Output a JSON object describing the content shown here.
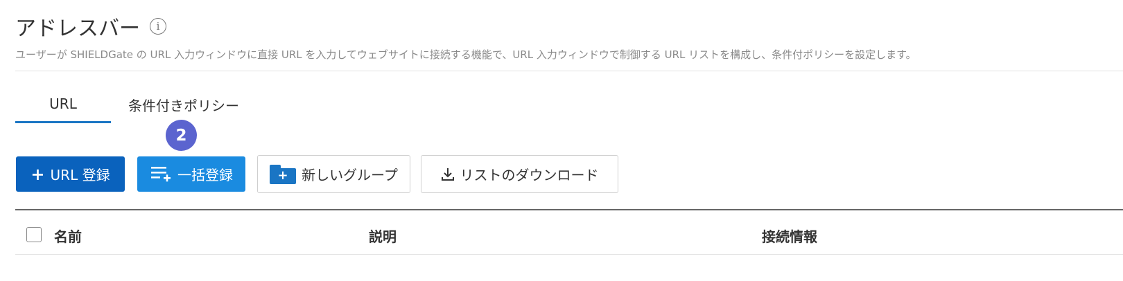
{
  "page": {
    "title": "アドレスバー",
    "info_icon_glyph": "i",
    "description": "ユーザーが SHIELDGate の URL 入力ウィンドウに直接 URL を入力してウェブサイトに接続する機能で、URL 入力ウィンドウで制御する URL リストを構成し、条件付ポリシーを設定します。"
  },
  "tabs": [
    {
      "label": "URL",
      "active": true
    },
    {
      "label": "条件付きポリシー",
      "active": false
    }
  ],
  "step_badge": "2",
  "toolbar": {
    "register_label": "URL 登録",
    "bulk_label": "一括登録",
    "new_group_label": "新しいグループ",
    "download_label": "リストのダウンロード"
  },
  "table": {
    "columns": [
      "名前",
      "説明",
      "接続情報"
    ]
  },
  "colors": {
    "primary": "#0a62bd",
    "bulk": "#1a8be0",
    "tab_underline": "#1a75c4",
    "badge": "#5b64cf"
  }
}
